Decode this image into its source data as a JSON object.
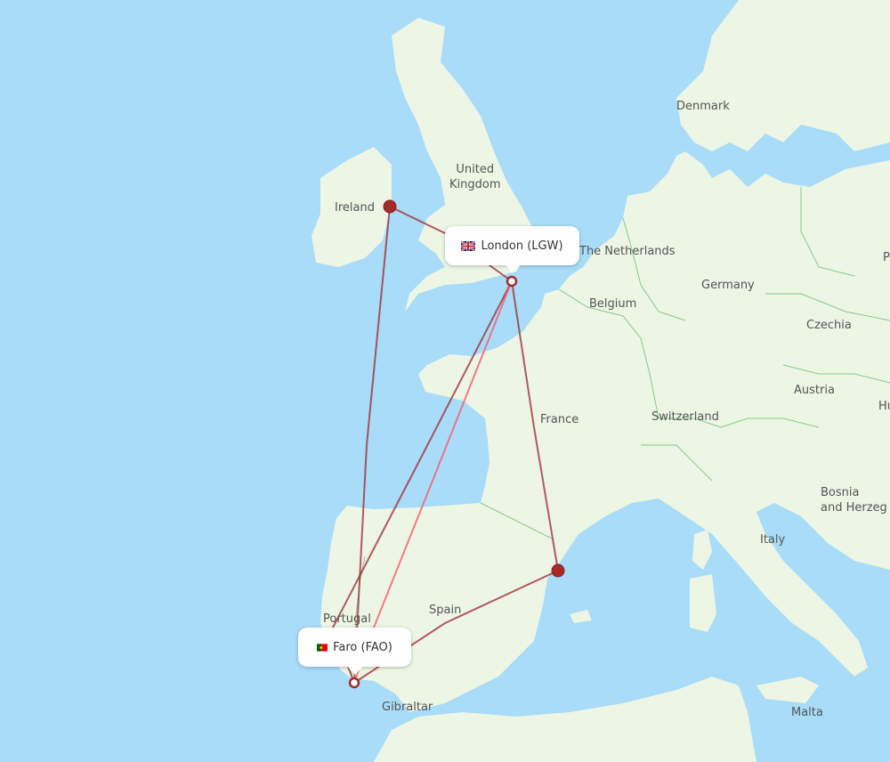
{
  "map": {
    "colors": {
      "water": "#a8dcf8",
      "land": "#edf5e4",
      "border": "#8cc98c",
      "route_primary": "#a0323c",
      "route_secondary": "#f26470",
      "airport_marker": "#a52a2a"
    },
    "country_labels": [
      {
        "id": "denmark",
        "text": "Denmark"
      },
      {
        "id": "united-kingdom",
        "text": "United\nKingdom"
      },
      {
        "id": "ireland",
        "text": "Ireland"
      },
      {
        "id": "the-netherlands",
        "text": "The Netherlands"
      },
      {
        "id": "germany",
        "text": "Germany"
      },
      {
        "id": "belgium",
        "text": "Belgium"
      },
      {
        "id": "czechia",
        "text": "Czechia"
      },
      {
        "id": "austria",
        "text": "Austria"
      },
      {
        "id": "switzerland",
        "text": "Switzerland"
      },
      {
        "id": "france",
        "text": "France"
      },
      {
        "id": "italy",
        "text": "Italy"
      },
      {
        "id": "bosnia",
        "text": "Bosnia\nand Herzeg"
      },
      {
        "id": "spain",
        "text": "Spain"
      },
      {
        "id": "portugal",
        "text": "Portugal"
      },
      {
        "id": "gibraltar",
        "text": "Gibraltar"
      },
      {
        "id": "malta",
        "text": "Malta"
      },
      {
        "id": "poland-partial",
        "text": "P"
      },
      {
        "id": "hungary-partial",
        "text": "Hu"
      }
    ],
    "airports": {
      "origin": {
        "name": "London",
        "code": "LGW",
        "label": "London (LGW)",
        "country": "United Kingdom"
      },
      "destination": {
        "name": "Faro",
        "code": "FAO",
        "label": "Faro (FAO)",
        "country": "Portugal"
      },
      "stops": [
        {
          "id": "dublin",
          "near": "Ireland"
        },
        {
          "id": "valencia",
          "near": "Spain east coast"
        }
      ]
    },
    "routes": [
      {
        "from": "dublin",
        "to": "London",
        "style": "primary"
      },
      {
        "from": "dublin",
        "to": "Faro",
        "style": "primary"
      },
      {
        "from": "London",
        "to": "Faro",
        "style": "primary"
      },
      {
        "from": "London",
        "to": "Faro",
        "style": "secondary"
      },
      {
        "from": "London",
        "to": "valencia",
        "style": "primary"
      },
      {
        "from": "valencia",
        "to": "Faro",
        "style": "primary"
      }
    ]
  }
}
